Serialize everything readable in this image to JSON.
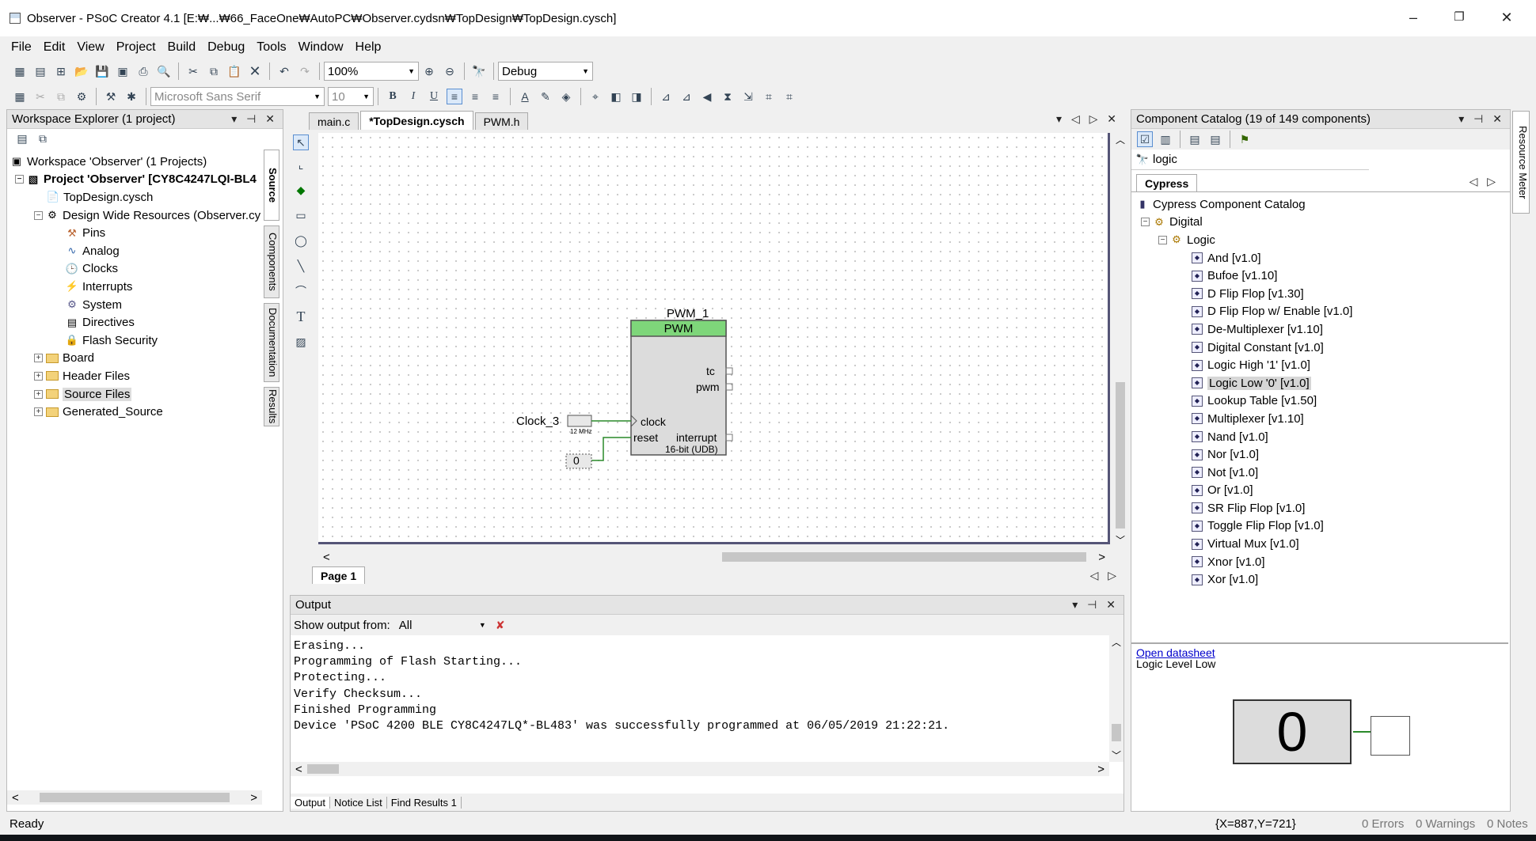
{
  "window": {
    "title": "Observer - PSoC Creator 4.1  [E:₩...₩66_FaceOne₩AutoPC₩Observer.cydsn₩TopDesign₩TopDesign.cysch]",
    "minimize": "–",
    "maximize": "❐",
    "close": "✕"
  },
  "menu": [
    "File",
    "Edit",
    "View",
    "Project",
    "Build",
    "Debug",
    "Tools",
    "Window",
    "Help"
  ],
  "toolbar": {
    "zoom": "100%",
    "config": "Debug",
    "font": "Microsoft Sans Serif",
    "font_size": "10"
  },
  "workspace": {
    "title": "Workspace Explorer (1 project)",
    "items": [
      {
        "label": "Workspace 'Observer' (1 Projects)"
      },
      {
        "label": "Project  'Observer' [CY8C4247LQI-BL4"
      },
      {
        "label": "TopDesign.cysch"
      },
      {
        "label": "Design Wide Resources (Observer.cy"
      },
      {
        "label": "Pins"
      },
      {
        "label": "Analog"
      },
      {
        "label": "Clocks"
      },
      {
        "label": "Interrupts"
      },
      {
        "label": "System"
      },
      {
        "label": "Directives"
      },
      {
        "label": "Flash Security"
      },
      {
        "label": "Board"
      },
      {
        "label": "Header Files"
      },
      {
        "label": "Source Files"
      },
      {
        "label": "Generated_Source"
      }
    ],
    "side_tabs": [
      "Source",
      "Components",
      "Documentation",
      "Results"
    ]
  },
  "editor": {
    "tabs": [
      "main.c",
      "*TopDesign.cysch",
      "PWM.h"
    ],
    "page_tab": "Page 1",
    "schematic": {
      "instance": "PWM_1",
      "component": "PWM",
      "tc": "tc",
      "pwm": "pwm",
      "clock": "clock",
      "reset": "reset",
      "interrupt": "interrupt",
      "mode": "16-bit (UDB)",
      "clock_name": "Clock_3",
      "clock_freq": "12 MHz",
      "const": "0"
    }
  },
  "output": {
    "title": "Output",
    "show_from_label": "Show output from:",
    "show_from_value": "All",
    "lines": [
      "Erasing...",
      "Programming of Flash Starting...",
      "Protecting...",
      "Verify Checksum...",
      "Finished Programming",
      "Device 'PSoC 4200 BLE CY8C4247LQ*-BL483' was successfully programmed at 06/05/2019 21:22:21."
    ],
    "tabs": [
      "Output",
      "Notice List",
      "Find Results 1"
    ]
  },
  "catalog": {
    "title": "Component Catalog (19 of 149 components)",
    "search": "logic",
    "tab": "Cypress",
    "root": "Cypress Component Catalog",
    "cat1": "Digital",
    "cat2": "Logic",
    "items": [
      "And [v1.0]",
      "Bufoe [v1.10]",
      "D Flip Flop [v1.30]",
      "D Flip Flop w/ Enable [v1.0]",
      "De-Multiplexer [v1.10]",
      "Digital Constant [v1.0]",
      "Logic High '1' [v1.0]",
      "Logic Low '0' [v1.0]",
      "Lookup Table [v1.50]",
      "Multiplexer [v1.10]",
      "Nand [v1.0]",
      "Nor [v1.0]",
      "Not [v1.0]",
      "Or [v1.0]",
      "SR Flip Flop [v1.0]",
      "Toggle Flip Flop [v1.0]",
      "Virtual Mux [v1.0]",
      "Xnor [v1.0]",
      "Xor [v1.0]"
    ],
    "selected": "Logic Low '0' [v1.0]",
    "datasheet_link": "Open datasheet",
    "preview_title": "Logic Level Low",
    "preview_value": "0",
    "side_tab": "Resource Meter"
  },
  "status": {
    "left": "Ready",
    "coords": "{X=887,Y=721}",
    "errors": "0 Errors",
    "warnings": "0 Warnings",
    "notes": "0 Notes"
  }
}
